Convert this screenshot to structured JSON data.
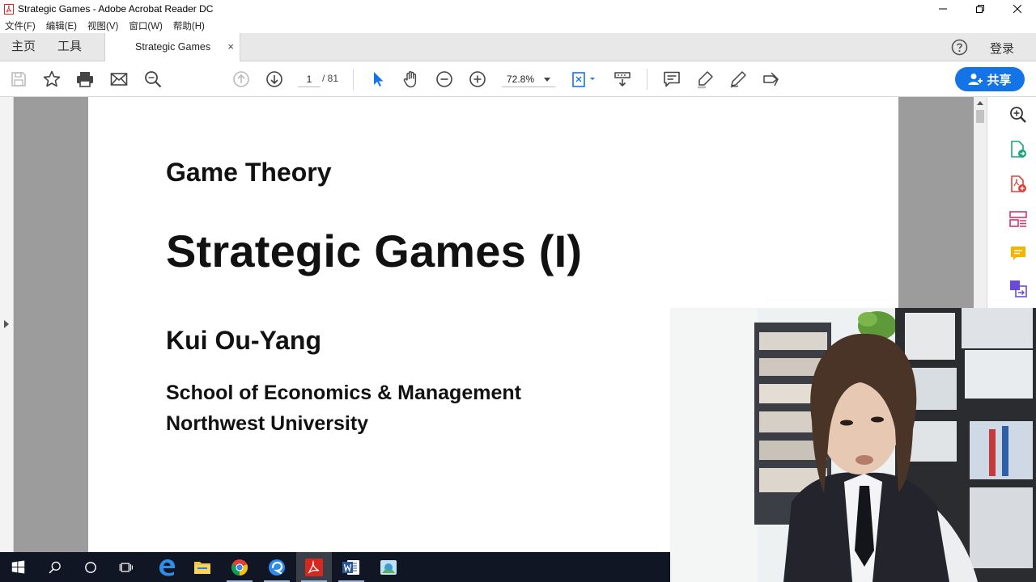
{
  "window": {
    "title": "Strategic Games - Adobe Acrobat Reader DC"
  },
  "menu": [
    "文件(F)",
    "编辑(E)",
    "视图(V)",
    "窗口(W)",
    "帮助(H)"
  ],
  "tabbar": {
    "home": "主页",
    "tools": "工具",
    "doc_tab": "Strategic Games",
    "close": "×",
    "login": "登录"
  },
  "toolbar": {
    "page_current": "1",
    "page_total": "/ 81",
    "zoom": "72.8%",
    "share": "共享"
  },
  "document": {
    "line1": "Game Theory",
    "line2": "Strategic Games (I)",
    "line3": "Kui Ou-Yang",
    "line4": "School of Economics & Management",
    "line5": "Northwest University"
  },
  "colors": {
    "accent": "#1473e6",
    "taskbar": "#101624",
    "acrobat_red": "#d7281e"
  },
  "right_panel_icons": [
    "zoom-tool-icon",
    "export-pdf-icon",
    "create-pdf-icon",
    "organize-pages-icon",
    "comment-icon",
    "convert-icon"
  ],
  "taskbar_icons": [
    "windows-start-icon",
    "search-icon",
    "cortana-icon",
    "task-view-icon",
    "edge-icon",
    "file-explorer-icon",
    "chrome-icon",
    "app-icon",
    "acrobat-icon",
    "word-icon",
    "app-icon-2"
  ]
}
